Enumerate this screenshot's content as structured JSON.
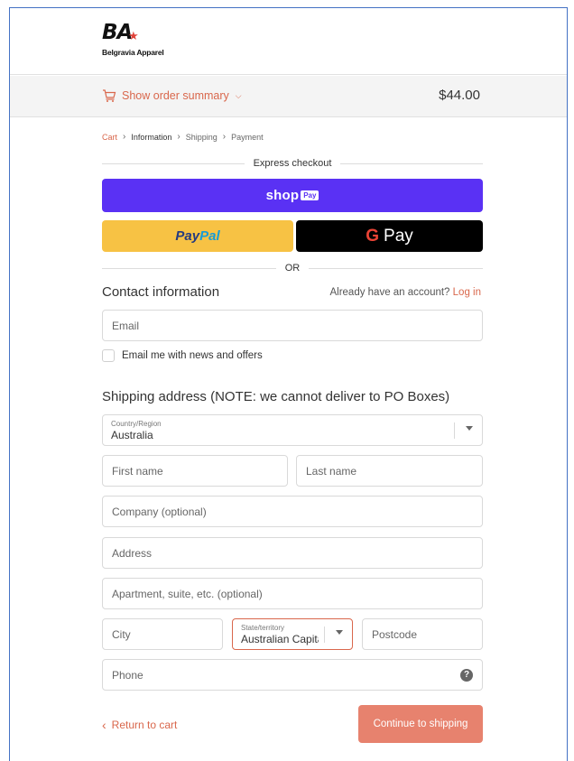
{
  "header": {
    "logo_mark": "BA",
    "logo_text": "Belgravia Apparel"
  },
  "summary": {
    "toggle_label": "Show order summary",
    "total": "$44.00"
  },
  "breadcrumb": {
    "items": [
      "Cart",
      "Information",
      "Shipping",
      "Payment"
    ],
    "current": "Information"
  },
  "express": {
    "label": "Express checkout",
    "shop_word": "shop",
    "shop_badge": "Pay",
    "paypal_a": "Pay",
    "paypal_b": "Pal",
    "gpay_g": "G",
    "gpay_label": "Pay",
    "or_label": "OR"
  },
  "contact": {
    "title": "Contact information",
    "account_prompt": "Already have an account?",
    "login_label": "Log in",
    "email_placeholder": "Email",
    "newsletter_label": "Email me with news and offers"
  },
  "shipping": {
    "title": "Shipping address (NOTE: we cannot deliver to PO Boxes)",
    "country_label": "Country/Region",
    "country_value": "Australia",
    "first_name_placeholder": "First name",
    "last_name_placeholder": "Last name",
    "company_placeholder": "Company (optional)",
    "address_placeholder": "Address",
    "apartment_placeholder": "Apartment, suite, etc. (optional)",
    "city_placeholder": "City",
    "state_label": "State/territory",
    "state_value": "Australian Capital Te",
    "postcode_placeholder": "Postcode",
    "phone_placeholder": "Phone"
  },
  "actions": {
    "return_label": "Return to cart",
    "continue_label": "Continue to shipping"
  },
  "colors": {
    "accent": "#d9674c",
    "shop_pay": "#5a31f4",
    "paypal": "#f7c244",
    "gpay": "#000000",
    "continue_button": "#e7826e"
  }
}
